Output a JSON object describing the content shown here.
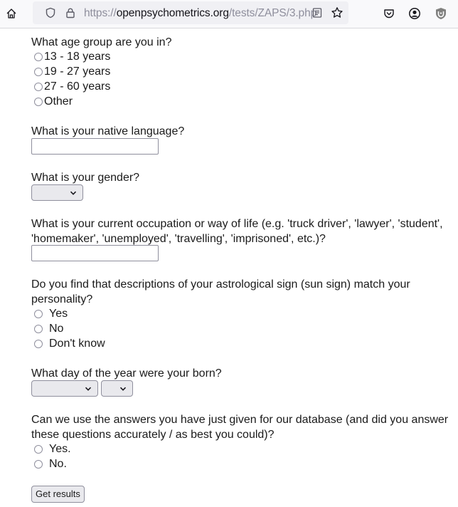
{
  "browser": {
    "url_scheme": "https://",
    "url_domain": "openpsychometrics.org",
    "url_path": "/tests/ZAPS/3.php",
    "icons": [
      "home-icon",
      "shield-icon",
      "lock-icon",
      "reader-view-icon",
      "bookmark-star-icon",
      "pocket-icon",
      "account-icon",
      "extension-icon"
    ]
  },
  "form": {
    "age": {
      "question": "What age group are you in?",
      "options": [
        "13 - 18 years",
        "19 - 27 years",
        "27 - 60 years",
        "Other"
      ]
    },
    "language": {
      "question": "What is your native language?",
      "value": ""
    },
    "gender": {
      "question": "What is your gender?",
      "selected": ""
    },
    "occupation": {
      "question": "What is your current occupation or way of life (e.g. 'truck driver', 'lawyer', 'student', 'homemaker', 'unemployed', 'travelling', 'imprisoned', etc.)?",
      "value": ""
    },
    "astrology": {
      "question": "Do you find that descriptions of your astrological sign (sun sign) match your personality?",
      "options": [
        "Yes",
        "No",
        "Don't know"
      ]
    },
    "birthday": {
      "question": "What day of the year were your born?",
      "month_selected": "",
      "day_selected": ""
    },
    "consent": {
      "question": "Can we use the answers you have just given for our database (and did you answer these questions accurately / as best you could)?",
      "options": [
        "Yes.",
        "No."
      ]
    },
    "submit_label": "Get results"
  }
}
